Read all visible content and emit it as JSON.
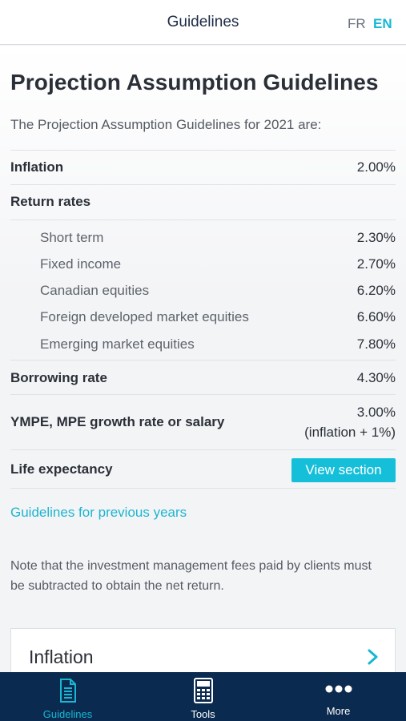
{
  "header": {
    "title": "Guidelines",
    "lang_fr": "FR",
    "lang_en": "EN"
  },
  "page": {
    "title": "Projection Assumption Guidelines",
    "intro": "The Projection Assumption Guidelines for 2021 are:"
  },
  "rows": {
    "inflation": {
      "label": "Inflation",
      "value": "2.00%"
    },
    "return_rates": {
      "label": "Return rates"
    },
    "short_term": {
      "label": "Short term",
      "value": "2.30%"
    },
    "fixed_income": {
      "label": "Fixed income",
      "value": "2.70%"
    },
    "canadian_equities": {
      "label": "Canadian equities",
      "value": "6.20%"
    },
    "foreign_developed": {
      "label": "Foreign developed market equities",
      "value": "6.60%"
    },
    "emerging": {
      "label": "Emerging market equities",
      "value": "7.80%"
    },
    "borrowing": {
      "label": "Borrowing rate",
      "value": "4.30%"
    },
    "ympe": {
      "label": "YMPE, MPE growth rate or salary",
      "value": "3.00%",
      "value_note": "(inflation + 1%)"
    },
    "life_expectancy": {
      "label": "Life expectancy",
      "button": "View section"
    }
  },
  "previous_years_link": "Guidelines for previous years",
  "note": "Note that the investment management fees paid by clients must be subtracted to obtain the net return.",
  "card": {
    "title": "Inflation"
  },
  "tabs": {
    "guidelines": {
      "label": "Guidelines",
      "icon": "document-icon"
    },
    "tools": {
      "label": "Tools",
      "icon": "calculator-icon"
    },
    "more": {
      "label": "More",
      "icon": "more-dots-icon"
    }
  },
  "colors": {
    "accent": "#16b8d3",
    "navy": "#0b2a4f",
    "button": "#16bfd9"
  }
}
